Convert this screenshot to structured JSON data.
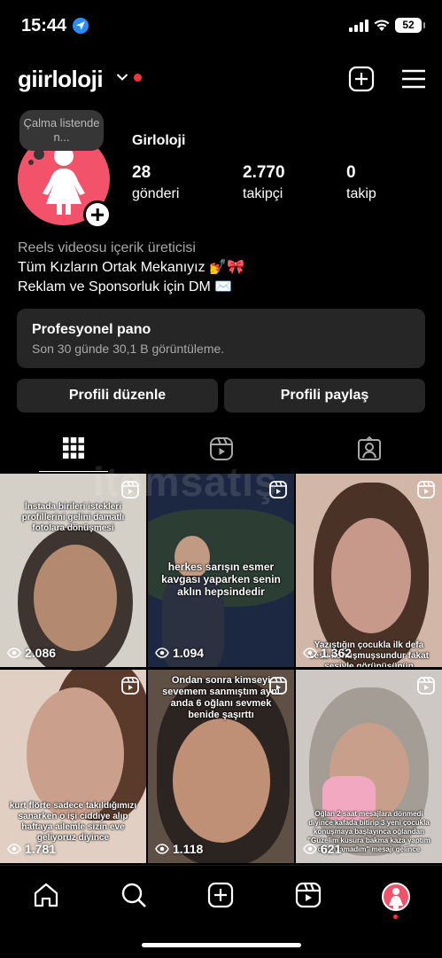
{
  "status_bar": {
    "time": "15:44",
    "battery": "52",
    "icons": [
      "location-arrow-icon",
      "signal-icon",
      "wifi-icon",
      "battery-icon"
    ]
  },
  "header": {
    "username": "giirloloji",
    "icons": [
      "chevron-down-icon",
      "new-post-icon",
      "menu-icon"
    ],
    "notification_color": "#ff3040"
  },
  "profile": {
    "note": "Çalma listende n...",
    "display_name": "Girloloji",
    "avatar_color": "#f2536a",
    "stats": [
      {
        "value": "28",
        "label": "gönderi"
      },
      {
        "value": "2.770",
        "label": "takipçi"
      },
      {
        "value": "0",
        "label": "takip"
      }
    ],
    "bio": {
      "category": "Reels videosu içerik üreticisi",
      "line1": "Tüm Kızların Ortak Mekanıyız 💅🎀",
      "line2": "Reklam ve Sponsorluk için DM ✉️"
    }
  },
  "dashboard": {
    "title": "Profesyonel pano",
    "subtitle": "Son 30 günde 30,1 B görüntüleme."
  },
  "buttons": {
    "edit": "Profili düzenle",
    "share": "Profili paylaş"
  },
  "tabs": [
    "grid-icon",
    "reels-icon",
    "tagged-icon"
  ],
  "watermark": "itemsatış",
  "grid": [
    {
      "views": "2.086",
      "caption": "İnstada birileri istekleri profillerini gelini damatlı fotolara dönüşmesi",
      "bg": "#d8d4cc"
    },
    {
      "views": "1.094",
      "caption": "herkes sarışın esmer kavgası yaparken senin aklın hepsindedir",
      "bg": "#1e2a44"
    },
    {
      "views": "1.362",
      "caption": "Yazıştığın çocukla ilk defa sesli konuşmuşsundur fakat sesiyle görünüşünün",
      "bg": "#b98b78"
    },
    {
      "views": "1.781",
      "caption": "kurt flörte sadece takıldığımızı sanarken o işi ciddiye alıp haftaya ailemle sizin eve geliyoruz diyince",
      "bg": "#d9c3b3"
    },
    {
      "views": "1.118",
      "caption": "Ondan sonra kimseyi sevemem sanmıştım aynı anda 6 oğlanı sevmek benide şaşırttı",
      "bg": "#6a5a4e"
    },
    {
      "views": "621",
      "caption": "Oğlan 2 saat mesajlara dönmedi diyince kafada bitirip 3 yeni çocukla konuşmaya başlayınca oğlandan \"Güzelim kusura bakma kaza yaptım da yazamadım\" mesajı gelince",
      "bg": "#cfcac5"
    }
  ],
  "bottom_nav": [
    "home-icon",
    "search-icon",
    "create-icon",
    "reels-icon",
    "profile-avatar"
  ]
}
